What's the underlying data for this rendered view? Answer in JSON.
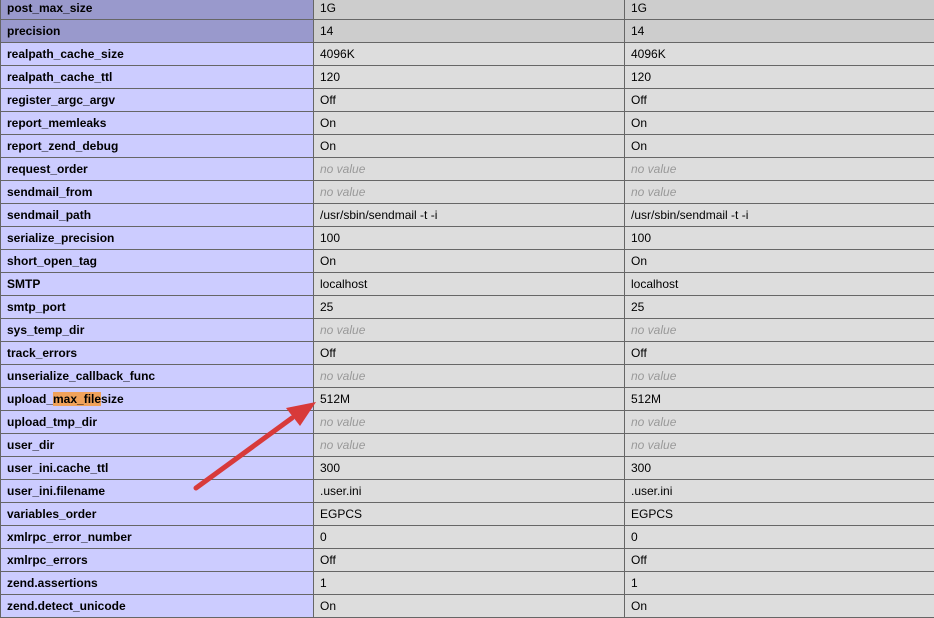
{
  "rows": [
    {
      "name": "post_max_size",
      "local": "1G",
      "master": "1G",
      "highlight": true
    },
    {
      "name": "precision",
      "local": "14",
      "master": "14",
      "highlight": true
    },
    {
      "name": "realpath_cache_size",
      "local": "4096K",
      "master": "4096K"
    },
    {
      "name": "realpath_cache_ttl",
      "local": "120",
      "master": "120"
    },
    {
      "name": "register_argc_argv",
      "local": "Off",
      "master": "Off"
    },
    {
      "name": "report_memleaks",
      "local": "On",
      "master": "On"
    },
    {
      "name": "report_zend_debug",
      "local": "On",
      "master": "On"
    },
    {
      "name": "request_order",
      "local": "no value",
      "master": "no value",
      "novalue": true
    },
    {
      "name": "sendmail_from",
      "local": "no value",
      "master": "no value",
      "novalue": true
    },
    {
      "name": "sendmail_path",
      "local": "/usr/sbin/sendmail -t -i",
      "master": "/usr/sbin/sendmail -t -i"
    },
    {
      "name": "serialize_precision",
      "local": "100",
      "master": "100"
    },
    {
      "name": "short_open_tag",
      "local": "On",
      "master": "On"
    },
    {
      "name": "SMTP",
      "local": "localhost",
      "master": "localhost"
    },
    {
      "name": "smtp_port",
      "local": "25",
      "master": "25"
    },
    {
      "name": "sys_temp_dir",
      "local": "no value",
      "master": "no value",
      "novalue": true
    },
    {
      "name": "track_errors",
      "local": "Off",
      "master": "Off"
    },
    {
      "name": "unserialize_callback_func",
      "local": "no value",
      "master": "no value",
      "novalue": true
    },
    {
      "name": "upload_max_filesize",
      "local": "512M",
      "master": "512M",
      "find": {
        "before": "upload_",
        "match": "max_file",
        "after": "size"
      }
    },
    {
      "name": "upload_tmp_dir",
      "local": "no value",
      "master": "no value",
      "novalue": true
    },
    {
      "name": "user_dir",
      "local": "no value",
      "master": "no value",
      "novalue": true
    },
    {
      "name": "user_ini.cache_ttl",
      "local": "300",
      "master": "300"
    },
    {
      "name": "user_ini.filename",
      "local": ".user.ini",
      "master": ".user.ini"
    },
    {
      "name": "variables_order",
      "local": "EGPCS",
      "master": "EGPCS"
    },
    {
      "name": "xmlrpc_error_number",
      "local": "0",
      "master": "0"
    },
    {
      "name": "xmlrpc_errors",
      "local": "Off",
      "master": "Off"
    },
    {
      "name": "zend.assertions",
      "local": "1",
      "master": "1"
    },
    {
      "name": "zend.detect_unicode",
      "local": "On",
      "master": "On"
    }
  ],
  "colors": {
    "directive_bg": "#ccccff",
    "value_bg": "#dddddd",
    "selected_row_bg": "#9999cc",
    "no_value_text": "#999999",
    "find_highlight": "#f0a25a",
    "annotation_arrow": "#d83a3a"
  },
  "annotation": {
    "type": "arrow",
    "points_to": "upload_max_filesize local value"
  }
}
